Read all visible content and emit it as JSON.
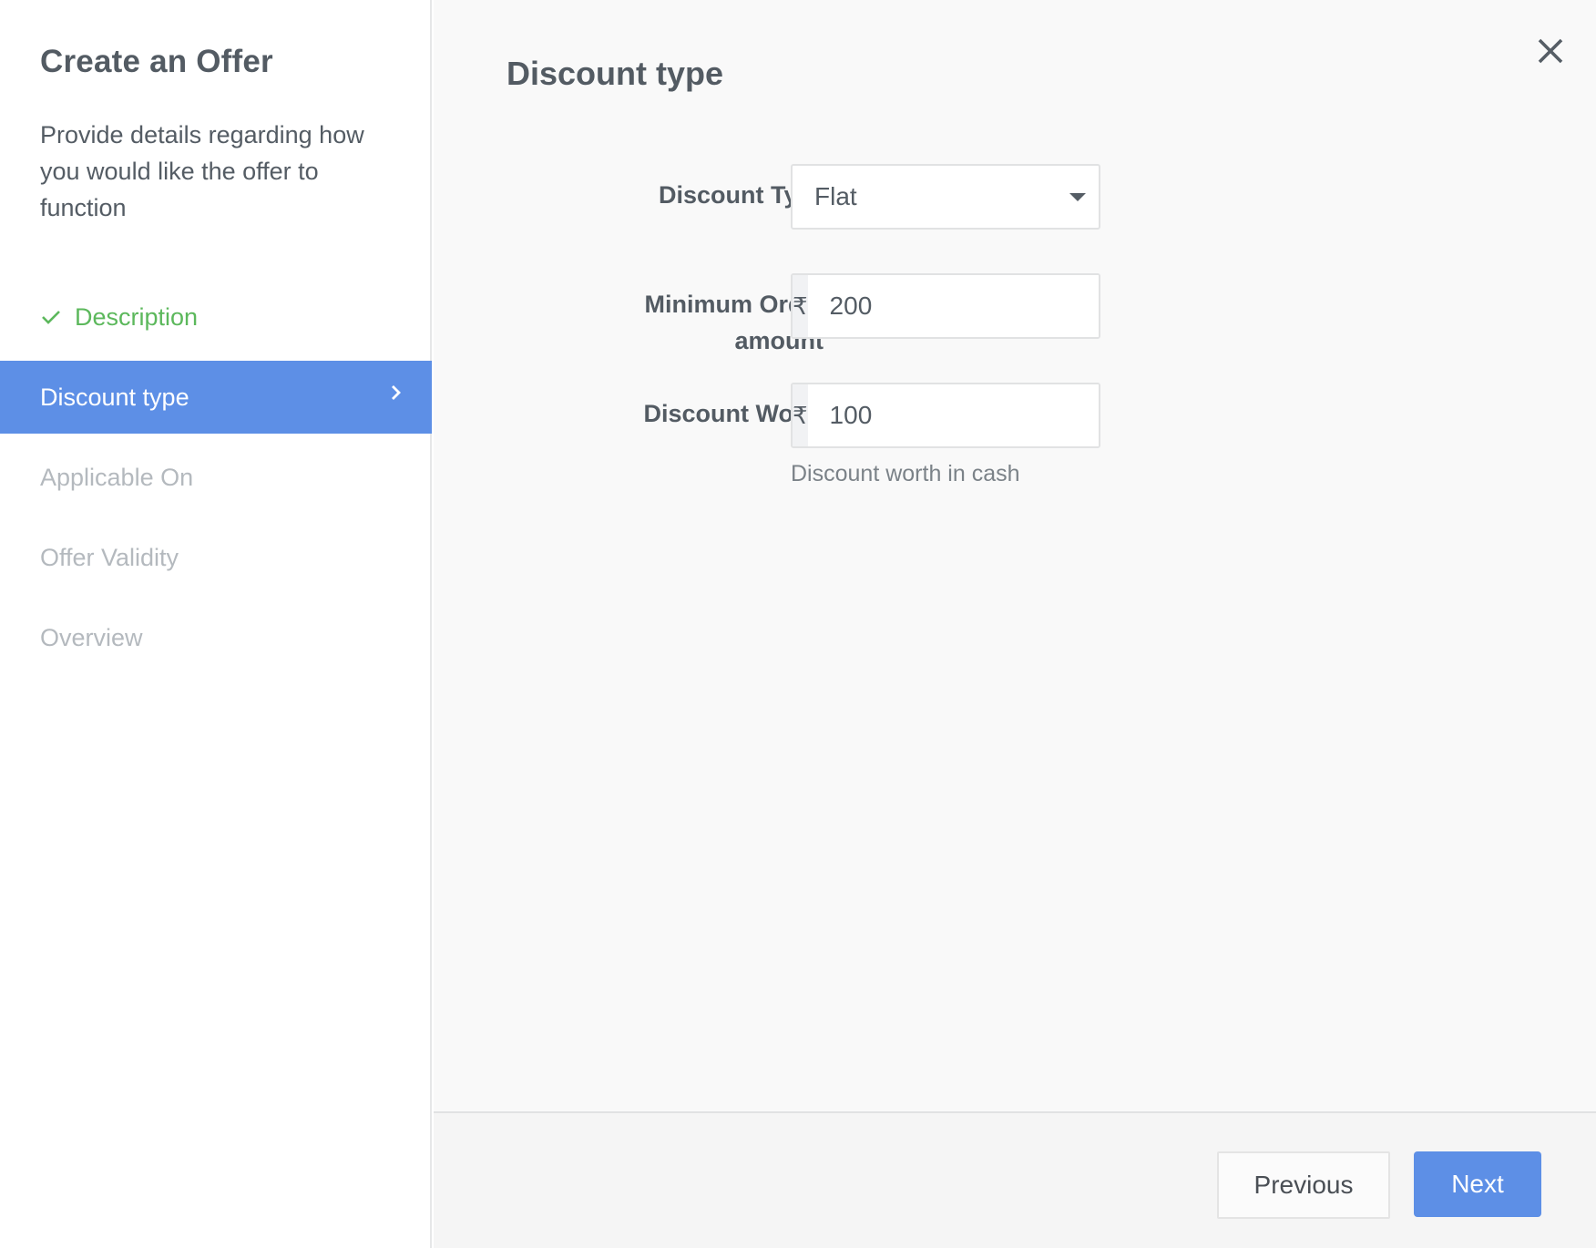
{
  "sidebar": {
    "title": "Create an Offer",
    "description": "Provide details regarding how you would like the offer to function",
    "steps": [
      {
        "label": "Description",
        "state": "completed"
      },
      {
        "label": "Discount type",
        "state": "active"
      },
      {
        "label": "Applicable On",
        "state": "pending"
      },
      {
        "label": "Offer Validity",
        "state": "pending"
      },
      {
        "label": "Overview",
        "state": "pending"
      }
    ]
  },
  "main": {
    "title": "Discount type",
    "close_icon": "close-icon",
    "form": {
      "discount_type": {
        "label": "Discount Type",
        "required_marker": "*",
        "selected_value": "Flat"
      },
      "minimum_order": {
        "label_line1": "Minimum Order",
        "label_line2": "amount",
        "required_marker": "*",
        "currency_symbol": "₹",
        "value": "200"
      },
      "discount_worth": {
        "label": "Discount Worth",
        "required_marker": "*",
        "currency_symbol": "₹",
        "value": "100",
        "help_text": "Discount worth in cash"
      }
    }
  },
  "footer": {
    "previous_label": "Previous",
    "next_label": "Next"
  },
  "colors": {
    "accent": "#5d8fe6",
    "success": "#5cb85c",
    "required": "#e05252",
    "pending_text": "#b4b9be",
    "text": "#535b63"
  }
}
